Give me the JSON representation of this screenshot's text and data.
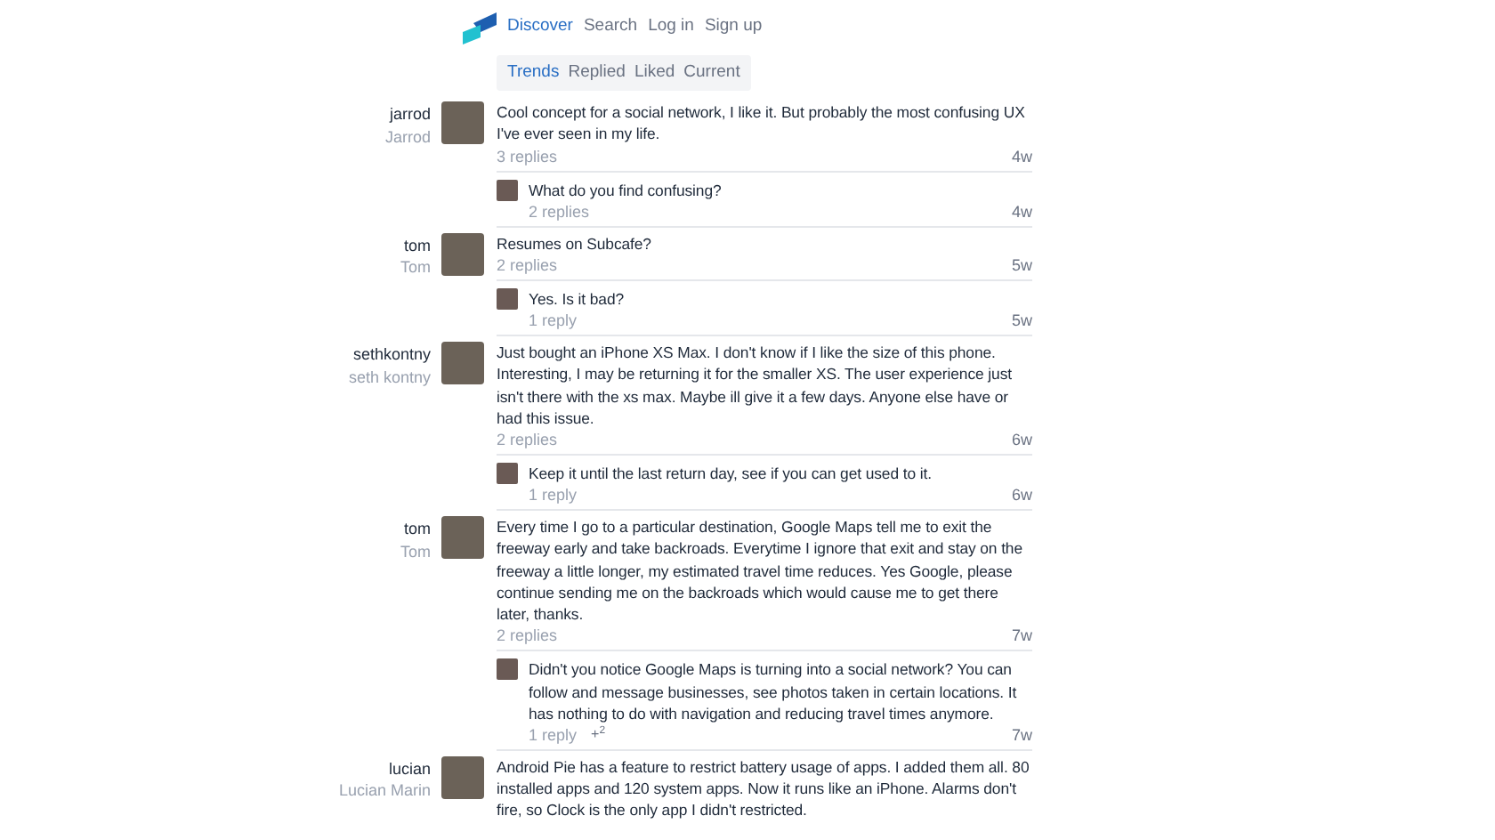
{
  "nav": [
    {
      "label": "Discover",
      "selected": true
    },
    {
      "label": "Search",
      "selected": false
    },
    {
      "label": "Log in",
      "selected": false
    },
    {
      "label": "Sign up",
      "selected": false
    }
  ],
  "tabs": [
    {
      "label": "Trends",
      "selected": true
    },
    {
      "label": "Replied",
      "selected": false
    },
    {
      "label": "Liked",
      "selected": false
    },
    {
      "label": "Current",
      "selected": false
    }
  ],
  "posts": [
    {
      "user": "jarrod",
      "display_name": "Jarrod",
      "text": "Cool concept for a social network, I like it. But probably the most confusing UX I've ever seen in my life.",
      "replies": "3 replies",
      "time": "4w",
      "reply": {
        "text": "What do you find confusing?",
        "replies": "2 replies",
        "time": "4w"
      }
    },
    {
      "user": "tom",
      "display_name": "Tom",
      "text": "Resumes on Subcafe?",
      "replies": "2 replies",
      "time": "5w",
      "reply": {
        "text": "Yes. Is it bad?",
        "replies": "1 reply",
        "time": "5w"
      }
    },
    {
      "user": "sethkontny",
      "display_name": "seth kontny",
      "text": "Just bought an iPhone XS Max. I don't know if I like the size of this phone. Interesting, I may be returning it for the smaller XS. The user experience just isn't there with the xs max. Maybe ill give it a few days. Anyone else have or had this issue.",
      "replies": "2 replies",
      "time": "6w",
      "reply": {
        "text": "Keep it until the last return day, see if you can get used to it.",
        "replies": "1 reply",
        "time": "6w"
      }
    },
    {
      "user": "tom",
      "display_name": "Tom",
      "text": "Every time I go to a particular destination, Google Maps tell me to exit the freeway early and take backroads. Everytime I ignore that exit and stay on the freeway a little longer, my estimated travel time reduces. Yes Google, please continue sending me on the backroads which would cause me to get there later, thanks.",
      "replies": "2 replies",
      "time": "7w",
      "reply": {
        "text": "Didn't you notice Google Maps is turning into a social network? You can follow and message businesses, see photos taken in certain locations. It has nothing to do with navigation and reducing travel times anymore.",
        "replies": "1 reply",
        "plus": "+$^{2}$",
        "time": "7w"
      }
    },
    {
      "user": "lucian",
      "display_name": "Lucian Marin",
      "text": "Android Pie has a feature to restrict battery usage of apps. I added them all. 80 installed apps and 120 system apps. Now it runs like an iPhone. Alarms don't fire, so Clock is the only app I didn't restricted."
    }
  ]
}
